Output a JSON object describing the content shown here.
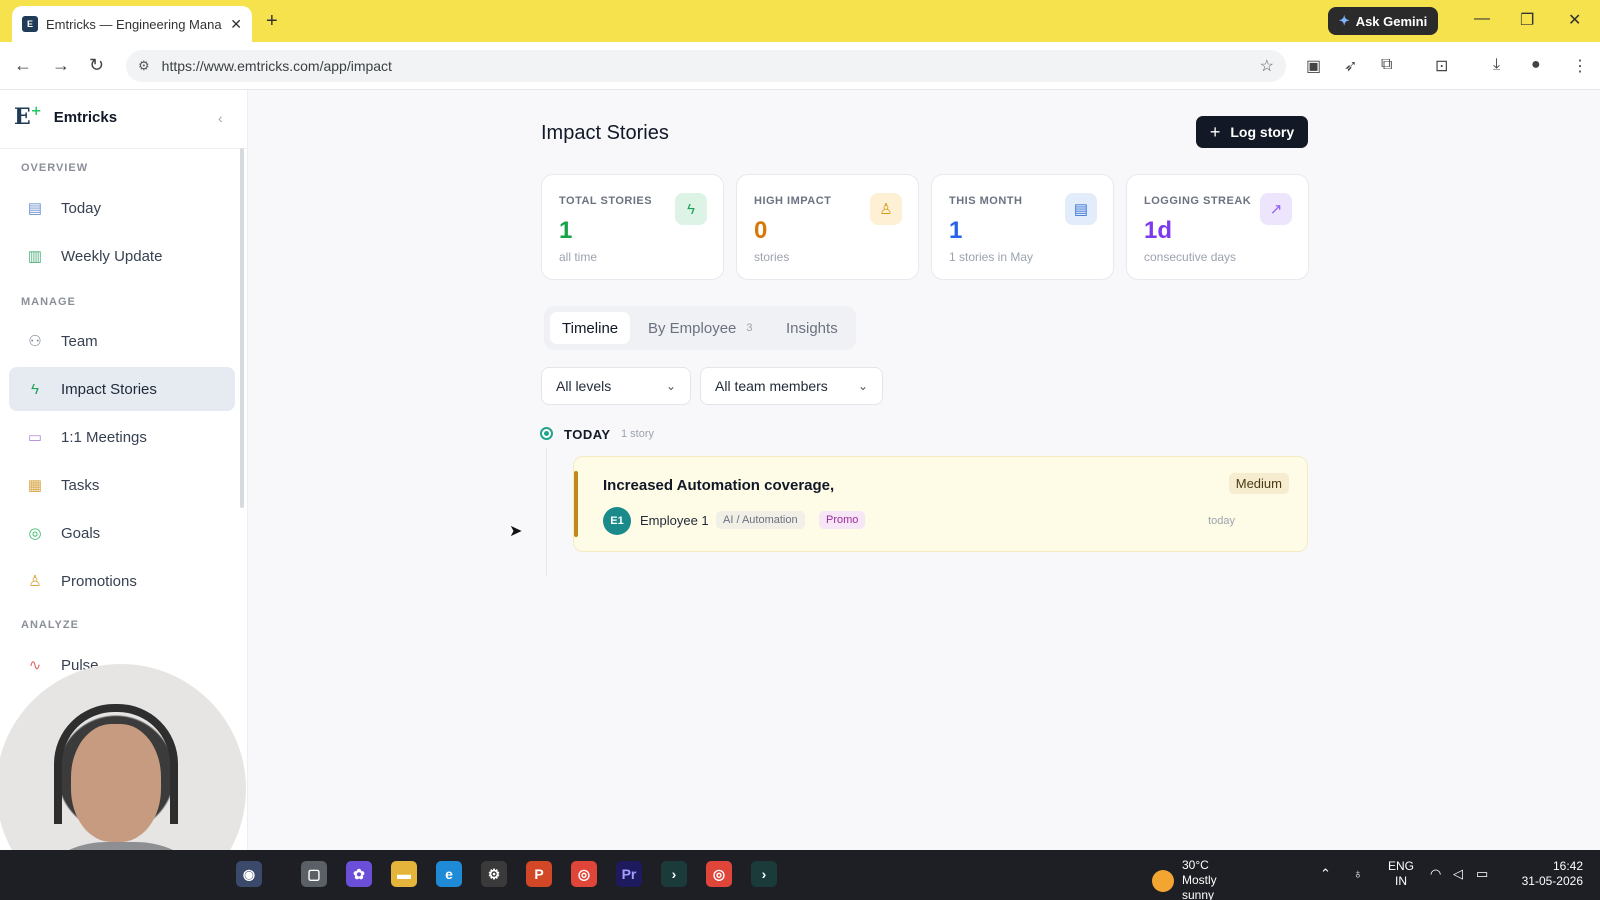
{
  "browser": {
    "tab_title": "Emtricks — Engineering Manag",
    "tab_favicon": "E",
    "new_tab": "+",
    "close_tab": "✕",
    "gemini_label": "Ask Gemini",
    "url": "https://www.emtricks.com/app/impact"
  },
  "sidebar": {
    "brand_logo": "E",
    "brand_name": "Emtricks",
    "sections": {
      "overview": "OVERVIEW",
      "manage": "MANAGE",
      "analyze": "ANALYZE"
    },
    "items": [
      {
        "label": "Today",
        "icon": "calendar-check-icon"
      },
      {
        "label": "Weekly Update",
        "icon": "document-icon"
      },
      {
        "label": "Team",
        "icon": "users-icon"
      },
      {
        "label": "Impact Stories",
        "icon": "bolt-icon"
      },
      {
        "label": "1:1 Meetings",
        "icon": "chat-icon"
      },
      {
        "label": "Tasks",
        "icon": "kanban-icon"
      },
      {
        "label": "Goals",
        "icon": "target-icon"
      },
      {
        "label": "Promotions",
        "icon": "award-icon"
      },
      {
        "label": "Pulse",
        "icon": "activity-icon"
      }
    ]
  },
  "main": {
    "title": "Impact Stories",
    "log_button": "Log story",
    "stats": [
      {
        "label": "TOTAL STORIES",
        "value": "1",
        "sub": "all time",
        "color": "#16a34a",
        "icon_bg": "#dcf3e6",
        "icon": "bolt-icon"
      },
      {
        "label": "HIGH IMPACT",
        "value": "0",
        "sub": "stories",
        "color": "#d97706",
        "icon_bg": "#fdf0d5",
        "icon": "award-icon"
      },
      {
        "label": "THIS MONTH",
        "value": "1",
        "sub": "1 stories in May",
        "color": "#2563eb",
        "icon_bg": "#e2ecfb",
        "icon": "calendar-icon"
      },
      {
        "label": "LOGGING STREAK",
        "value": "1d",
        "sub": "consecutive days",
        "color": "#7c3aed",
        "icon_bg": "#ede5fb",
        "icon": "trend-up-icon"
      }
    ],
    "tabs": {
      "timeline": "Timeline",
      "by_employee": "By Employee",
      "by_employee_count": "3",
      "insights": "Insights"
    },
    "filters": {
      "level": "All levels",
      "members": "All team members"
    },
    "group": {
      "label": "TODAY",
      "count": "1 story"
    },
    "story": {
      "title": "Increased Automation coverage,",
      "level": "Medium",
      "avatar": "E1",
      "employee": "Employee 1",
      "category": "AI / Automation",
      "tag": "Promo",
      "time": "today"
    }
  },
  "taskbar": {
    "temperature": "30°C",
    "weather": "Mostly sunny",
    "lang1": "ENG",
    "lang2": "IN",
    "time": "16:42",
    "date": "31-05-2026"
  }
}
